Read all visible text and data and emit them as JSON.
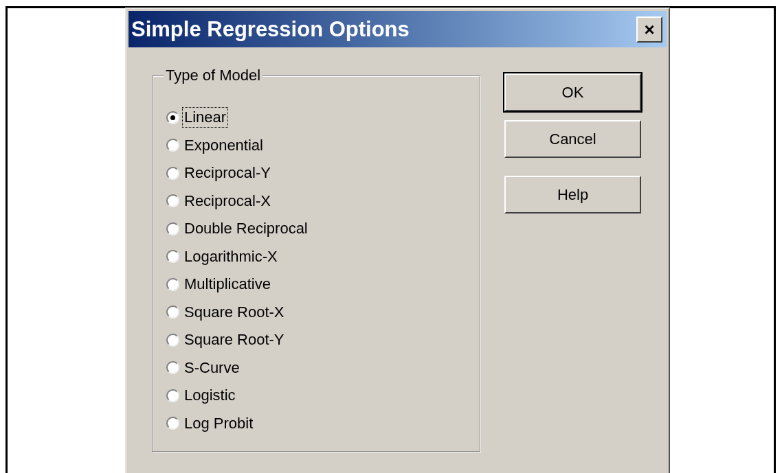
{
  "window": {
    "title": "Simple Regression Options",
    "close": "×"
  },
  "group": {
    "label": "Type of Model",
    "options": [
      {
        "label": "Linear",
        "selected": true
      },
      {
        "label": "Exponential",
        "selected": false
      },
      {
        "label": "Reciprocal-Y",
        "selected": false
      },
      {
        "label": "Reciprocal-X",
        "selected": false
      },
      {
        "label": "Double Reciprocal",
        "selected": false
      },
      {
        "label": "Logarithmic-X",
        "selected": false
      },
      {
        "label": "Multiplicative",
        "selected": false
      },
      {
        "label": "Square Root-X",
        "selected": false
      },
      {
        "label": "Square Root-Y",
        "selected": false
      },
      {
        "label": "S-Curve",
        "selected": false
      },
      {
        "label": "Logistic",
        "selected": false
      },
      {
        "label": "Log Probit",
        "selected": false
      }
    ]
  },
  "buttons": [
    {
      "label": "OK",
      "default": true
    },
    {
      "label": "Cancel",
      "default": false
    },
    {
      "label": "Help",
      "default": false
    }
  ]
}
